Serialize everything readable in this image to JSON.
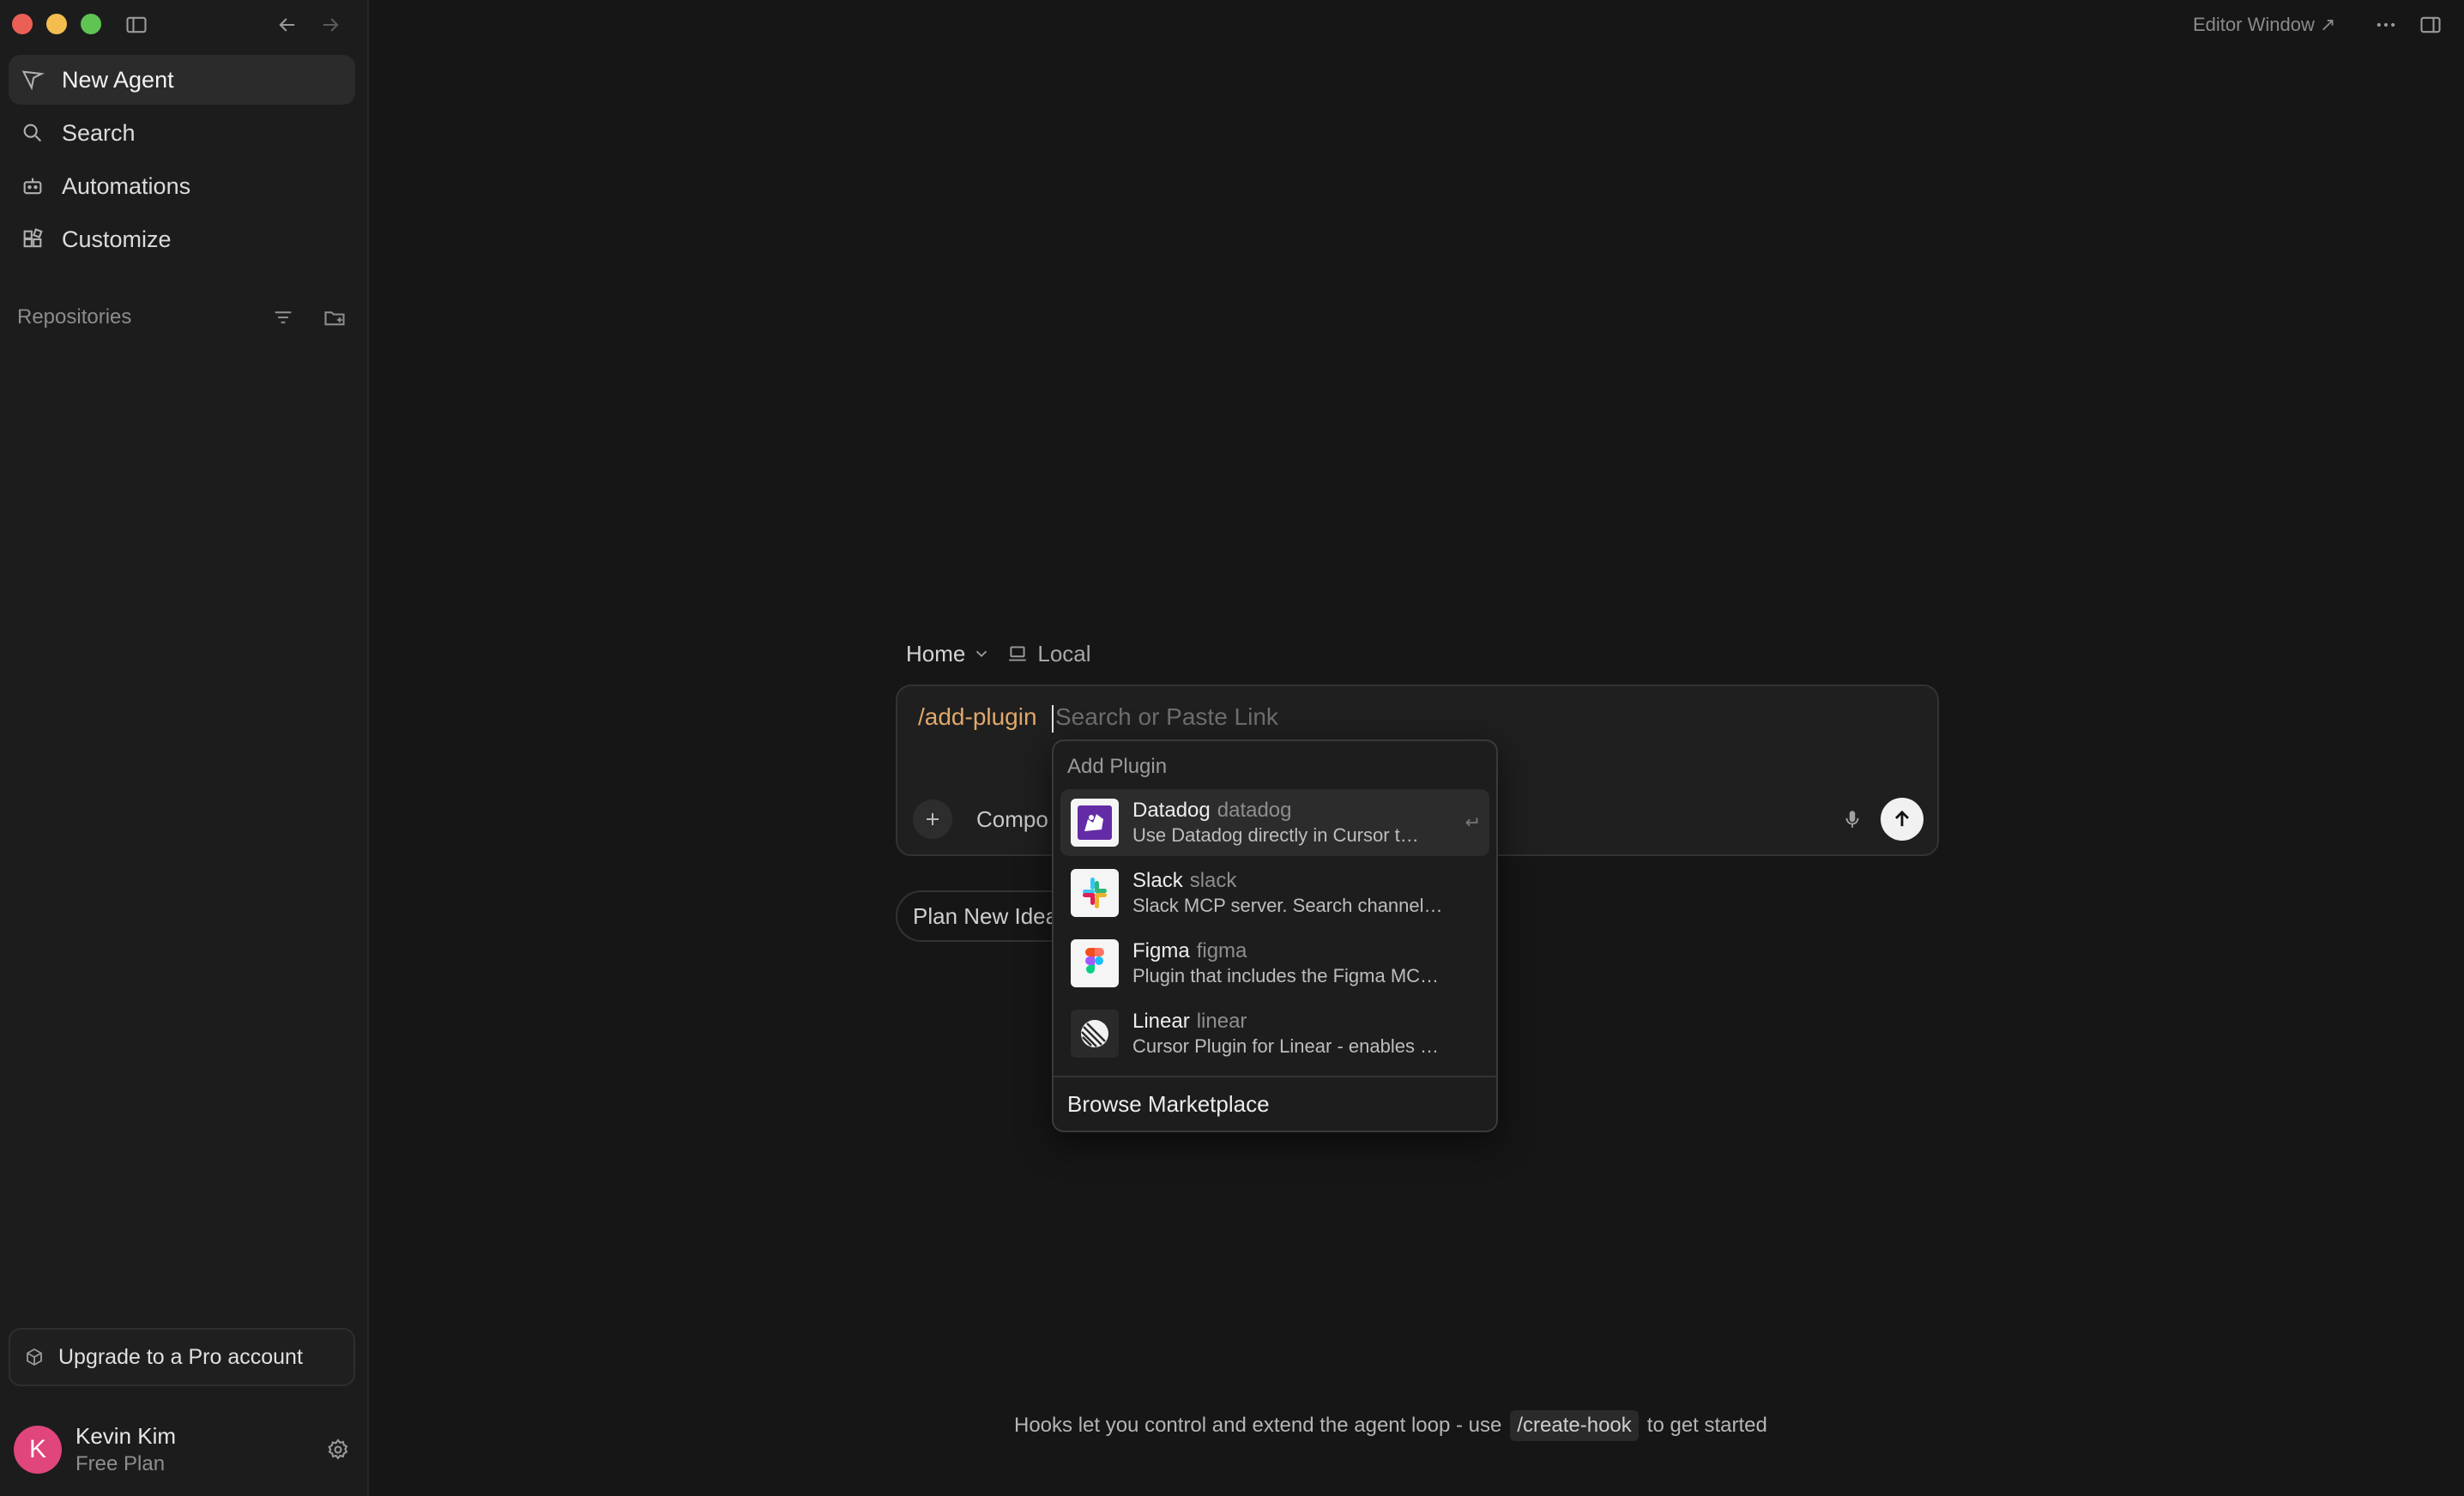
{
  "sidebar": {
    "nav": [
      {
        "label": "New Agent",
        "icon": "new-agent-icon"
      },
      {
        "label": "Search",
        "icon": "search-icon"
      },
      {
        "label": "Automations",
        "icon": "automations-icon"
      },
      {
        "label": "Customize",
        "icon": "customize-icon"
      }
    ],
    "repositories_label": "Repositories",
    "upgrade_label": "Upgrade to a Pro account",
    "user": {
      "initial": "K",
      "name": "Kevin Kim",
      "plan": "Free Plan"
    }
  },
  "topbar": {
    "editor_window_label": "Editor Window ↗"
  },
  "composer": {
    "breadcrumb_home": "Home",
    "breadcrumb_local": "Local",
    "command": "/add-plugin",
    "placeholder": "Search or Paste Link",
    "mode_label": "Compo",
    "chip_label": "Plan New Idea"
  },
  "dropdown": {
    "header": "Add Plugin",
    "items": [
      {
        "name": "Datadog",
        "slug": "datadog",
        "desc": "Use Datadog directly in Cursor t…"
      },
      {
        "name": "Slack",
        "slug": "slack",
        "desc": "Slack MCP server. Search channel…"
      },
      {
        "name": "Figma",
        "slug": "figma",
        "desc": "Plugin that includes the Figma MC…"
      },
      {
        "name": "Linear",
        "slug": "linear",
        "desc": "Cursor Plugin for Linear - enables …"
      }
    ],
    "browse_label": "Browse Marketplace"
  },
  "hint": {
    "before": "Hooks let you control and extend the agent loop - use",
    "code": "/create-hook",
    "after": "to get started"
  },
  "colors": {
    "accent_command": "#e0a86b",
    "avatar": "#e0457b"
  }
}
